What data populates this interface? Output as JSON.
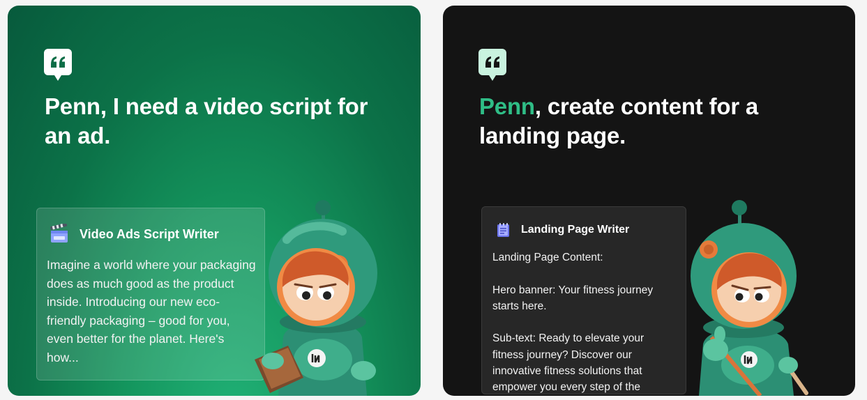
{
  "cards": [
    {
      "headline": "Penn, I need a video script for an ad.",
      "panel": {
        "title": "Video Ads Script Writer",
        "icon": "clapperboard-icon",
        "body": "Imagine a world where your packaging does as much good as the product inside. Introducing our new eco-friendly packaging – good for you, even better for the planet. Here's how..."
      }
    },
    {
      "headline_accent": "Penn",
      "headline_rest": ", create content for a landing page.",
      "panel": {
        "title": "Landing Page Writer",
        "icon": "notepad-icon",
        "lines": [
          "Landing Page Content:",
          "Hero banner: Your fitness journey starts here.",
          "Sub-text: Ready to elevate your fitness journey? Discover our innovative fitness solutions that empower you every step of the"
        ]
      }
    }
  ],
  "colors": {
    "green_card": "#0c7248",
    "dark_card": "#141414",
    "accent": "#2fbd86",
    "quote_icon_light": "#ffffff",
    "quote_icon_mint": "#c9f3df"
  }
}
